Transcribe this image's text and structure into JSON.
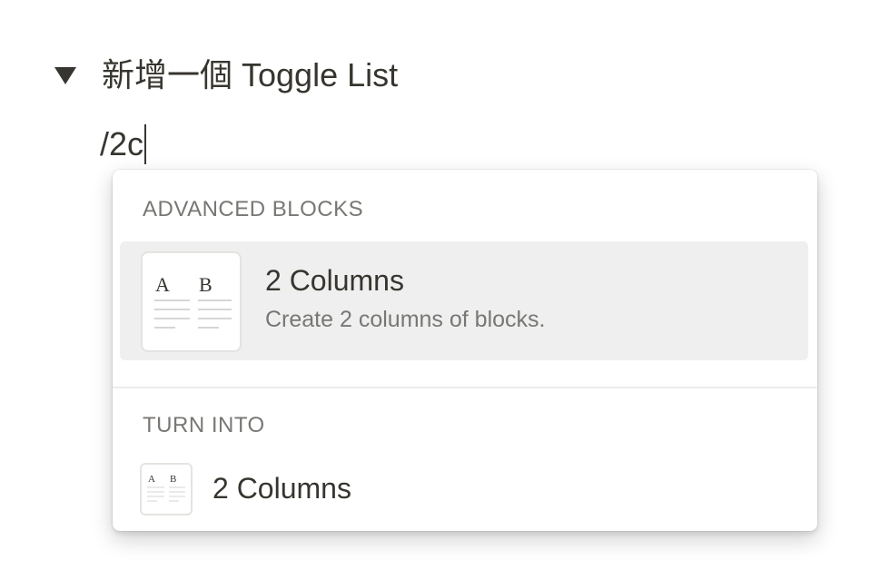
{
  "toggle": {
    "icon": "triangle-down-icon",
    "title": "新增一個 Toggle List"
  },
  "editor": {
    "slash_input": "/2c"
  },
  "menu": {
    "advanced_header": "ADVANCED BLOCKS",
    "advanced_items": [
      {
        "icon": "two-columns-thumbnail-icon",
        "thumb_letters": [
          "A",
          "B"
        ],
        "title": "2 Columns",
        "description": "Create 2 columns of blocks."
      }
    ],
    "turn_into_header": "TURN INTO",
    "turn_into_items": [
      {
        "icon": "two-columns-thumbnail-icon",
        "thumb_letters": [
          "A",
          "B"
        ],
        "title": "2 Columns"
      }
    ]
  },
  "colors": {
    "text": "#37352f",
    "muted": "#787774",
    "hover_bg": "#efefef"
  }
}
